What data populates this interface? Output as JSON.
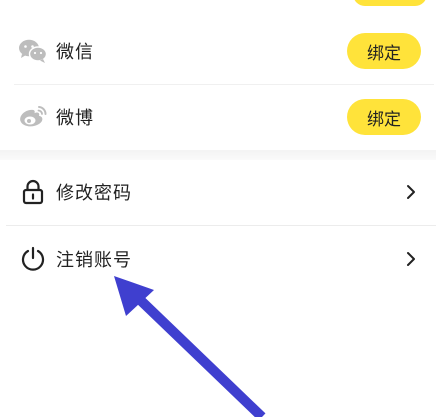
{
  "bindings": {
    "wechat": {
      "label": "微信",
      "button": "绑定",
      "icon": "wechat-icon"
    },
    "weibo": {
      "label": "微博",
      "button": "绑定",
      "icon": "weibo-icon"
    }
  },
  "menu": {
    "change_password": {
      "label": "修改密码",
      "icon": "lock-icon"
    },
    "cancel_account": {
      "label": "注销账号",
      "icon": "power-icon"
    }
  },
  "colors": {
    "accent": "#ffe33a",
    "text": "#222222",
    "icon_gray": "#bdbdbd",
    "annotation_arrow": "#3f3fcf"
  }
}
